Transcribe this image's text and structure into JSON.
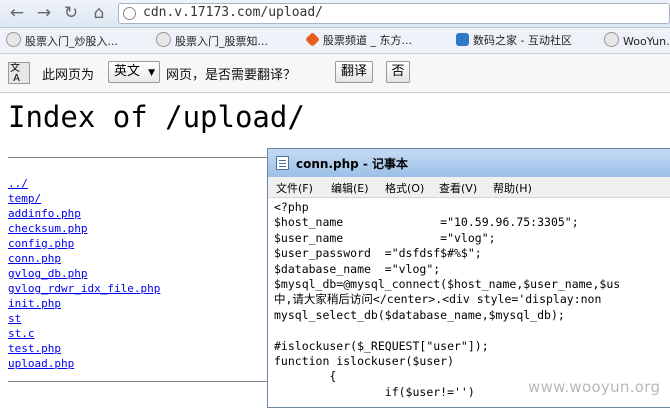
{
  "browser": {
    "url": "cdn.v.17173.com/upload/",
    "back_icon": "arrow-left-icon",
    "forward_icon": "arrow-right-icon",
    "reload_icon": "reload-icon",
    "home_icon": "home-icon"
  },
  "bookmarks": [
    {
      "label": "股票入门_炒股入..."
    },
    {
      "label": "股票入门_股票知..."
    },
    {
      "label": "股票频道 _ 东方..."
    },
    {
      "label": "数码之家 - 互动社区"
    },
    {
      "label": "WooYun.o"
    }
  ],
  "translate_bar": {
    "prefix": "此网页为",
    "language": "英文",
    "question": "网页，是否需要翻译？",
    "translate_label": "翻译",
    "no_label": "否"
  },
  "page": {
    "title": "Index of /upload/",
    "files": [
      "../",
      "temp/",
      "addinfo.php",
      "checksum.php",
      "config.php",
      "conn.php",
      "gvlog_db.php",
      "gvlog_rdwr_idx_file.php",
      "init.php",
      "st",
      "st.c",
      "test.php",
      "upload.php"
    ]
  },
  "notepad": {
    "title": "conn.php - 记事本",
    "menu": [
      "文件(F)",
      "编辑(E)",
      "格式(O)",
      "查看(V)",
      "帮助(H)"
    ],
    "code": "<?php\n$host_name              =\"10.59.96.75:3305\";\n$user_name              =\"vlog\";\n$user_password  =\"dsfdsf$#%$\";\n$database_name  =\"vlog\";\n$mysql_db=@mysql_connect($host_name,$user_name,$us\n中,请大家稍后访问</center>.<div style='display:non\nmysql_select_db($database_name,$mysql_db);\n\n#islockuser($_REQUEST[\"user\"]);\nfunction islockuser($user)\n        {\n                if($user!='')"
  },
  "watermark": "www.wooyun.org"
}
